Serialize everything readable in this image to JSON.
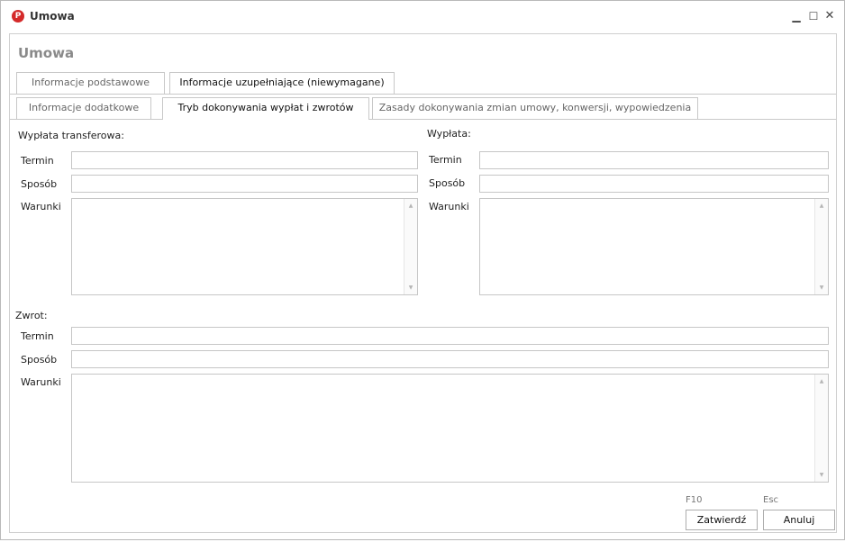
{
  "window": {
    "title": "Umowa",
    "logo_letter": "P",
    "controls": {
      "minimize": "▁",
      "maximize": "☐",
      "close": "✕"
    }
  },
  "form": {
    "title": "Umowa"
  },
  "tabs_row1": [
    {
      "label": "Informacje podstawowe",
      "active": false
    },
    {
      "label": "Informacje uzupełniające (niewymagane)",
      "active": true
    }
  ],
  "tabs_row2": [
    {
      "label": "Informacje dodatkowe",
      "active": false
    },
    {
      "label": "Tryb dokonywania wypłat i zwrotów",
      "active": true
    },
    {
      "label": "Zasady dokonywania zmian umowy, konwersji, wypowiedzenia",
      "active": false
    }
  ],
  "transfer": {
    "heading": "Wypłata transferowa:",
    "termin_label": "Termin",
    "termin_value": "",
    "sposob_label": "Sposób",
    "sposob_value": "",
    "warunki_label": "Warunki",
    "warunki_value": ""
  },
  "wyplata": {
    "heading": "Wypłata:",
    "termin_label": "Termin",
    "termin_value": "",
    "sposob_label": "Sposób",
    "sposob_value": "",
    "warunki_label": "Warunki",
    "warunki_value": ""
  },
  "zwrot": {
    "heading": "Zwrot:",
    "termin_label": "Termin",
    "termin_value": "",
    "sposob_label": "Sposób",
    "sposob_value": "",
    "warunki_label": "Warunki",
    "warunki_value": ""
  },
  "footer": {
    "confirm_shortcut": "F10",
    "cancel_shortcut": "Esc",
    "confirm_label": "Zatwierdź",
    "cancel_label": "Anuluj"
  }
}
